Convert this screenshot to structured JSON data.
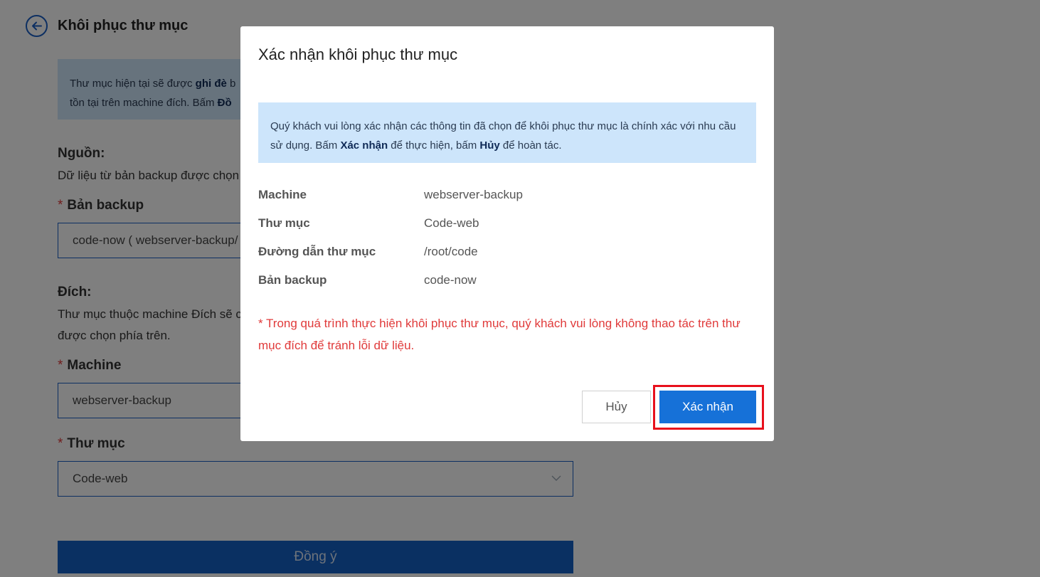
{
  "page": {
    "title": "Khôi phục thư mục",
    "info": {
      "line1_pre": "Thư mục hiện tại sẽ được ",
      "line1_bold": "ghi đè",
      "line1_post": " b",
      "line2_pre": "tồn tại trên machine đích. Bấm ",
      "line2_bold": "Đồ"
    },
    "source": {
      "title": "Nguồn:",
      "desc": "Dữ liệu từ bản backup được chọn"
    },
    "backup_field": {
      "required": "*",
      "label": "Bản backup",
      "value": "code-now ( webserver-backup/"
    },
    "dest": {
      "title": "Đích:",
      "desc_line1": "Thư mục thuộc machine Đích sẽ c",
      "desc_line2": "được chọn phía trên."
    },
    "machine_field": {
      "required": "*",
      "label": "Machine",
      "value": "webserver-backup"
    },
    "folder_field": {
      "required": "*",
      "label": "Thư mục",
      "value": "Code-web"
    },
    "submit_label": "Đồng ý"
  },
  "modal": {
    "title": "Xác nhận khôi phục thư mục",
    "notice": {
      "text1": "Quý khách vui lòng xác nhận các thông tin đã chọn để khôi phục thư mục là chính xác với nhu cầu sử dụng. Bấm ",
      "bold1": "Xác nhận",
      "text2": " để thực hiện, bấm ",
      "bold2": "Hủy",
      "text3": " để hoàn tác."
    },
    "details": [
      {
        "key": "Machine",
        "value": "webserver-backup"
      },
      {
        "key": "Thư mục",
        "value": "Code-web"
      },
      {
        "key": "Đường dẫn thư mục",
        "value": "/root/code"
      },
      {
        "key": "Bản backup",
        "value": "code-now"
      }
    ],
    "warning": "* Trong quá trình thực hiện khôi phục thư mục, quý khách vui lòng không thao tác trên thư mục đích để tránh lỗi dữ liệu.",
    "cancel_label": "Hủy",
    "confirm_label": "Xác nhận"
  },
  "colors": {
    "accent": "#1671d8",
    "highlight": "#e8101c",
    "warning": "#e03a3a",
    "notice_bg": "#cde5fb"
  },
  "icons": {
    "back": "arrow-left-circle-icon",
    "select": "chevron-down-icon"
  }
}
